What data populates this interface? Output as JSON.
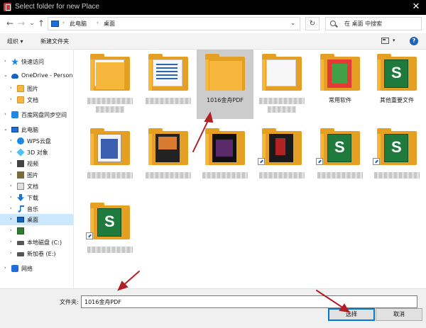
{
  "window": {
    "title": "Select folder for new Place",
    "close_glyph": "✕"
  },
  "nav": {
    "back_glyph": "←",
    "forward_glyph": "→",
    "recent_glyph": "⌄",
    "up_glyph": "↑"
  },
  "address": {
    "crumbs": [
      "此电脑",
      "桌面"
    ],
    "separator": "›",
    "dropdown_glyph": "⌄",
    "refresh_glyph": "↻"
  },
  "search": {
    "placeholder": "在 桌面 中搜索"
  },
  "toolbar": {
    "organize_label": "组织 ▾",
    "new_folder_label": "新建文件夹",
    "view_dropdown": "▾",
    "help_glyph": "?"
  },
  "navpane": {
    "items": [
      {
        "label": "快速访问",
        "icon": "star-icon"
      },
      {
        "label": "OneDrive - Persona",
        "icon": "cloud-icon"
      },
      {
        "label": "图片",
        "icon": "folder-icon"
      },
      {
        "label": "文档",
        "icon": "folder-icon"
      },
      {
        "label": "百度网盘同步空间",
        "icon": "baidu-cloud-icon"
      },
      {
        "label": "此电脑",
        "icon": "pc-icon"
      },
      {
        "label": "WPS云盘",
        "icon": "wps-cloud-icon"
      },
      {
        "label": "3D 对象",
        "icon": "3d-objects-icon"
      },
      {
        "label": "视频",
        "icon": "video-icon"
      },
      {
        "label": "图片",
        "icon": "pictures-icon"
      },
      {
        "label": "文档",
        "icon": "documents-icon"
      },
      {
        "label": "下载",
        "icon": "download-icon"
      },
      {
        "label": "音乐",
        "icon": "music-icon"
      },
      {
        "label": "桌面",
        "icon": "desktop-icon",
        "selected": true
      },
      {
        "label": "",
        "icon": "green-drive-icon"
      },
      {
        "label": "本地磁盘 (C:)",
        "icon": "drive-icon"
      },
      {
        "label": "新加卷 (E:)",
        "icon": "drive-icon"
      },
      {
        "label": "网络",
        "icon": "network-icon"
      }
    ],
    "chevron_right": "›",
    "chevron_down": "⌄"
  },
  "files": {
    "items": [
      {
        "label": "",
        "blurred": true,
        "cover": "none"
      },
      {
        "label": "",
        "blurred": true,
        "cover": "blue-doc"
      },
      {
        "label": "1016金舟PDF",
        "blurred": false,
        "cover": "none",
        "selected": true
      },
      {
        "label": "",
        "blurred": true,
        "cover": "paper"
      },
      {
        "label": "常用软件",
        "blurred": false,
        "cover": "colorful"
      },
      {
        "label": "其他重要文件",
        "blurred": false,
        "cover": "green"
      },
      {
        "label": "",
        "blurred": true,
        "cover": "bluebook"
      },
      {
        "label": "",
        "blurred": true,
        "cover": "orange"
      },
      {
        "label": "",
        "blurred": true,
        "cover": "poster"
      },
      {
        "label": "",
        "blurred": true,
        "cover": "darkred",
        "shortcut": true
      },
      {
        "label": "",
        "blurred": true,
        "cover": "green",
        "shortcut": true
      },
      {
        "label": "",
        "blurred": true,
        "cover": "green",
        "shortcut": true
      },
      {
        "label": "",
        "blurred": true,
        "cover": "green",
        "shortcut": true
      }
    ]
  },
  "bottom": {
    "filename_label": "文件夹:",
    "filename_value": "1016金舟PDF",
    "select_button": "选择",
    "cancel_button": "取消"
  },
  "colors": {
    "annotation_arrow": "#b21f24",
    "selected_nav": "#cce8ff",
    "selected_tile": "#cccccc",
    "folder": "#f6b73c"
  }
}
